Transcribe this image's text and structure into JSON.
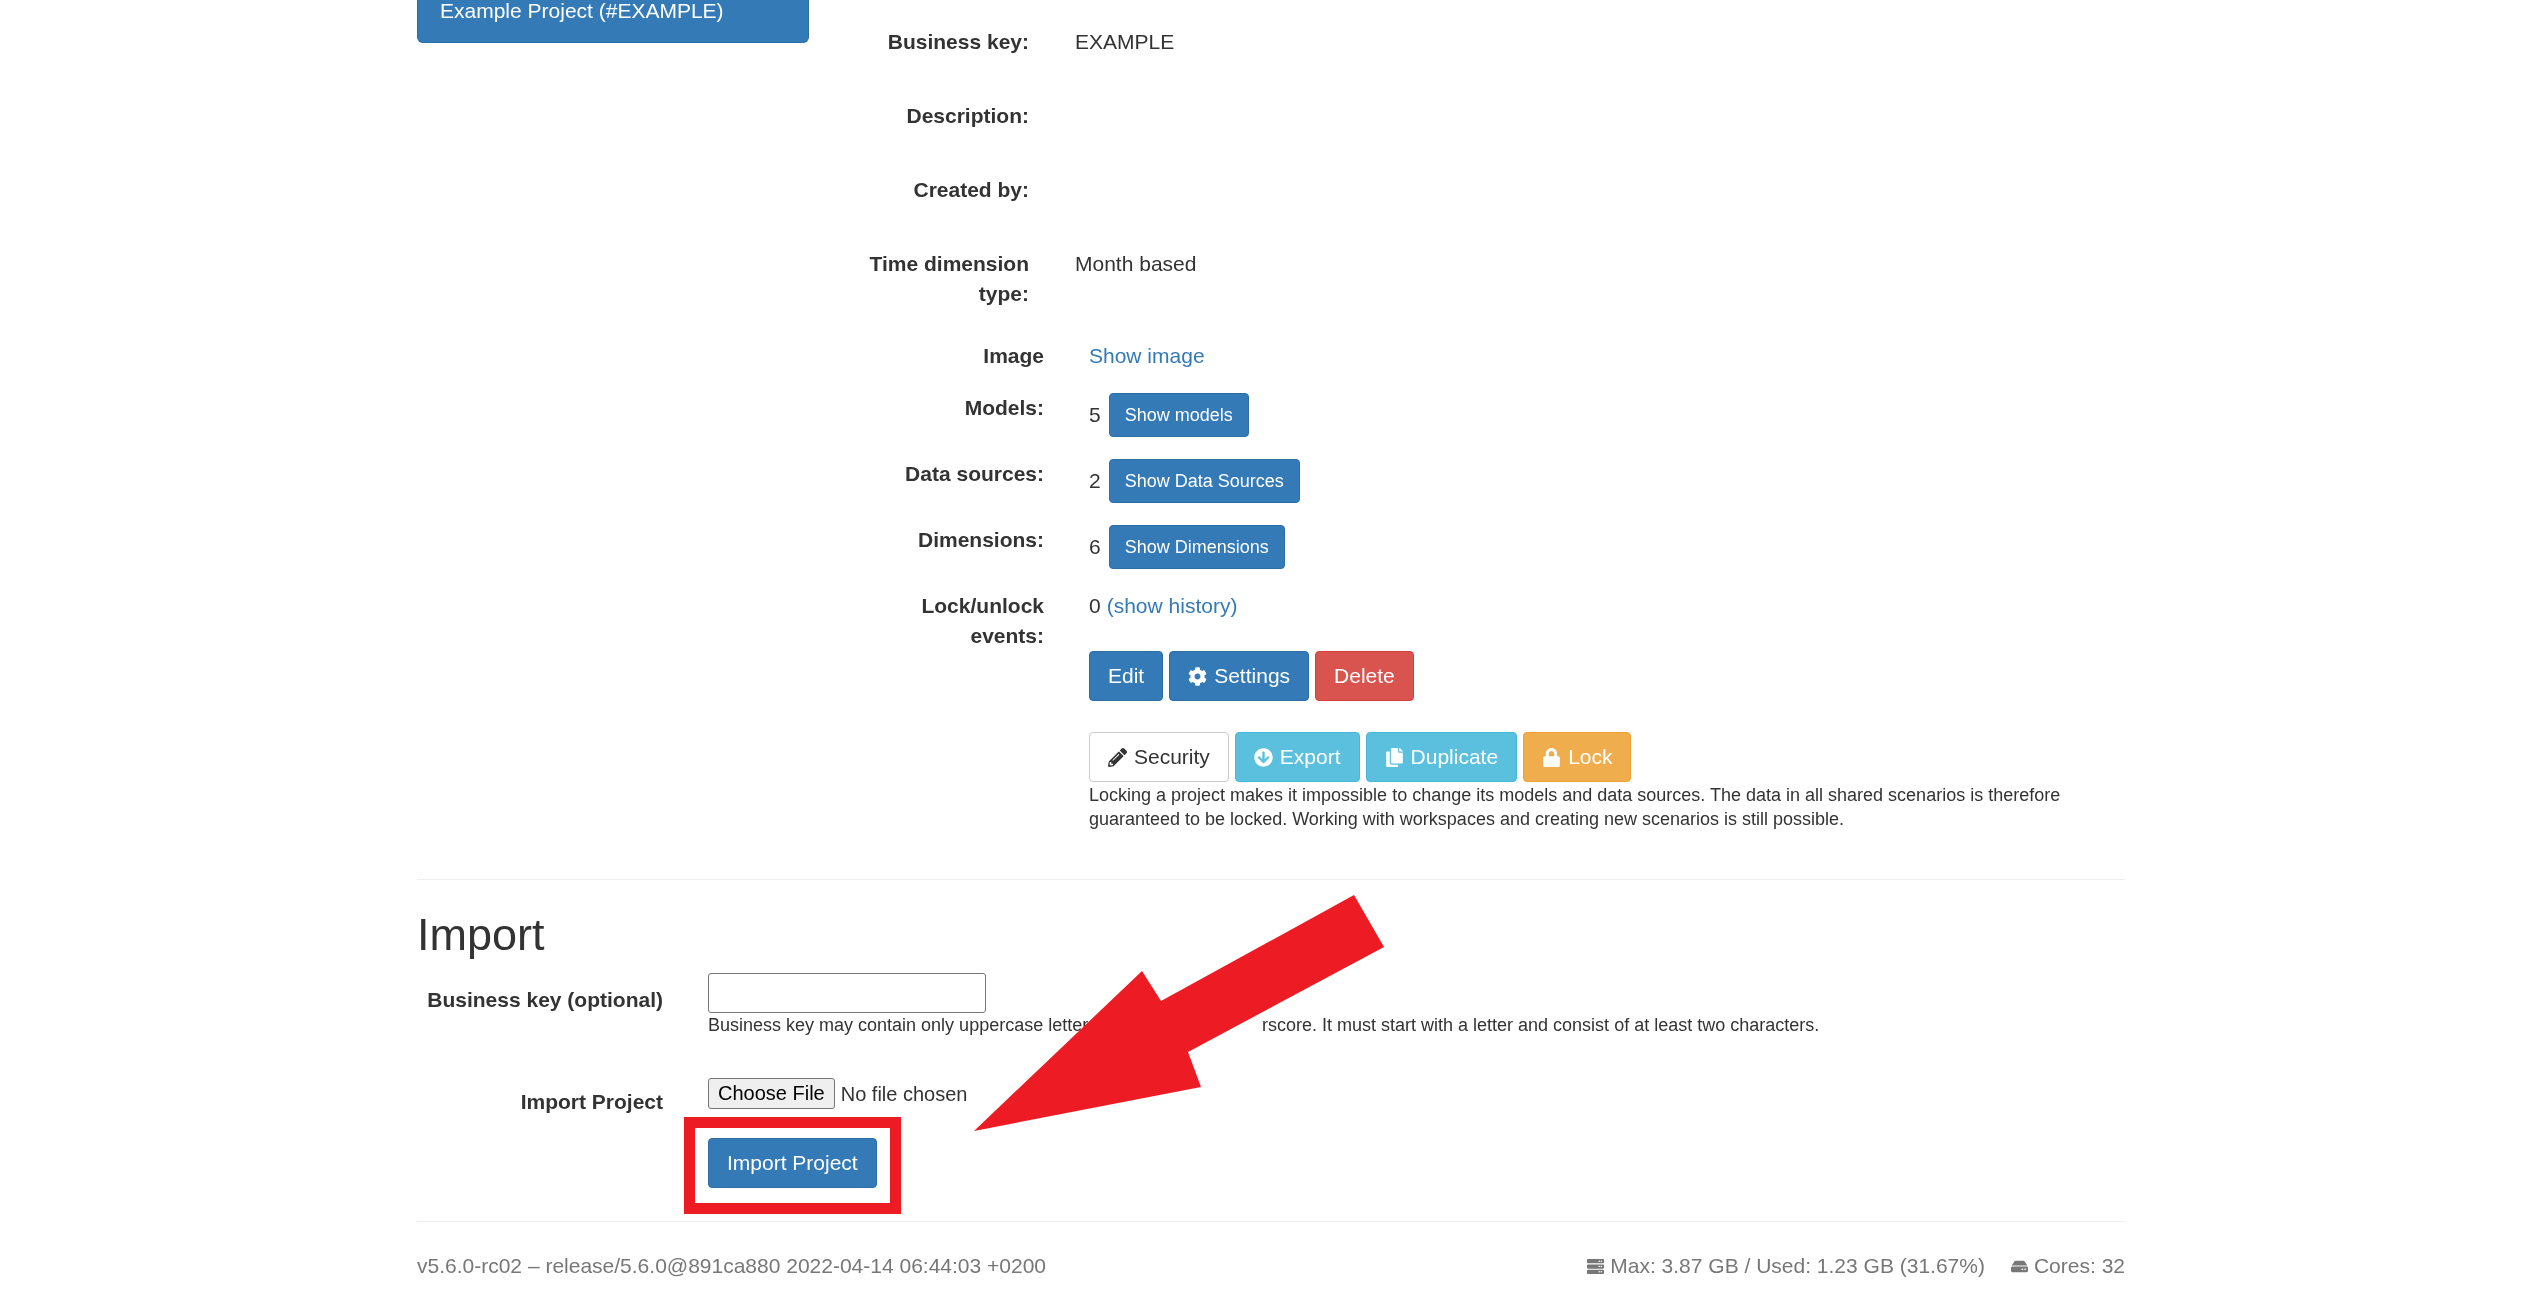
{
  "project_button": {
    "label": "Example Project (#EXAMPLE)"
  },
  "details": [
    {
      "label": "Business key:",
      "value": "EXAMPLE"
    },
    {
      "label": "Description:"
    },
    {
      "label": "Created by:"
    },
    {
      "label": "Time dimension type:",
      "value": "Month based"
    }
  ],
  "resources": [
    {
      "kind": "link",
      "label": "Image",
      "link": "Show image"
    },
    {
      "kind": "count",
      "label": "Models:",
      "count": "5",
      "button": "Show models"
    },
    {
      "kind": "count",
      "label": "Data sources:",
      "count": "2",
      "button": "Show Data Sources"
    },
    {
      "kind": "count",
      "label": "Dimensions:",
      "count": "6",
      "button": "Show Dimensions"
    },
    {
      "kind": "history",
      "label": "Lock/unlock events:",
      "count": "0",
      "link": "(show history)"
    }
  ],
  "action_rows": [
    {
      "buttons": [
        {
          "kind": "edit",
          "label": "Edit"
        },
        {
          "kind": "settings",
          "label": "Settings"
        },
        {
          "kind": "delete",
          "label": "Delete"
        }
      ]
    },
    {
      "buttons": [
        {
          "kind": "security",
          "label": "Security"
        },
        {
          "kind": "export",
          "label": "Export"
        },
        {
          "kind": "duplicate",
          "label": "Duplicate"
        },
        {
          "kind": "lock",
          "label": "Lock"
        }
      ]
    }
  ],
  "lock_note": "Locking a project makes it impossible to change its models and data sources. The data in all shared scenarios is therefore guaranteed to be locked. Working with workspaces and creating new scenarios is still possible.",
  "import": {
    "title": "Import",
    "fields": [
      {
        "kind": "text",
        "label": "Business key (optional)",
        "help": [
          "Business key may contain only uppercase letter",
          "rscore. It must start with a letter and consist of at least two characters."
        ]
      },
      {
        "kind": "file",
        "label": "Import Project",
        "button": "Choose File",
        "status": "No file chosen"
      }
    ],
    "submit": "Import Project"
  },
  "footer": {
    "version": "v5.6.0-rc02 – release/5.6.0@891ca880 2022-04-14 06:44:03 +0200",
    "memory": "Max: 3.87 GB / Used: 1.23 GB (31.67%)",
    "cores": "Cores: 32"
  }
}
